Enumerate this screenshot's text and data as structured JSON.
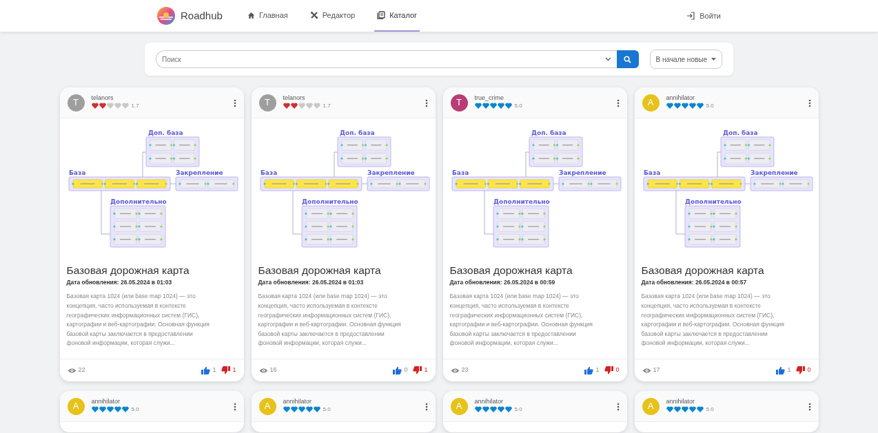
{
  "navbar": {
    "logo": "Roadhub",
    "links": [
      {
        "label": "Главная",
        "selected": false
      },
      {
        "label": "Редактор",
        "selected": false
      },
      {
        "label": "Каталог",
        "selected": true
      }
    ],
    "login": "Войти"
  },
  "search": {
    "placeholder": "Поиск",
    "sort": "В начале новые"
  },
  "cards": [
    {
      "author": "telanors",
      "avatar": {
        "letter": "T",
        "color": "#9e9e9e"
      },
      "rating": {
        "stars": 2,
        "color": "#d32f2f",
        "value": "1.7"
      },
      "groups": [
        "Доп. база",
        "База",
        "Закрепление",
        "Дополнительно"
      ],
      "title": "Базовая дорожная карта",
      "updated": "Дата обновления: 26.05.2024 в 01:03",
      "description": "Базовая карта 1024 (или base map 1024) — это концепция, часто используемая в контексте географических информационных систем (ГИС), картографии и веб-картографии. Основная функция базовой карты заключается в предоставлении фоновой информации, которая служи...",
      "views": "22",
      "likes": "1",
      "dislikes": "1"
    },
    {
      "author": "telanors",
      "avatar": {
        "letter": "T",
        "color": "#9e9e9e"
      },
      "rating": {
        "stars": 2,
        "color": "#d32f2f",
        "value": "1.7"
      },
      "groups": [
        "Доп. база",
        "База",
        "Закрепление",
        "Дополнительно"
      ],
      "title": "Базовая дорожная карта",
      "updated": "Дата обновления: 26.05.2024 в 01:03",
      "description": "Базовая карта 1024 (или base map 1024) — это концепция, часто используемая в контексте географических информационных систем (ГИС), картографии и веб-картографии. Основная функция базовой карты заключается в предоставлении фоновой информации, которая служи...",
      "views": "16",
      "likes": "0",
      "dislikes": "1"
    },
    {
      "author": "true_crime",
      "avatar": {
        "letter": "T",
        "color": "#b83d74"
      },
      "rating": {
        "stars": 5,
        "color": "#0a86d0",
        "value": "5.0"
      },
      "groups": [
        "Доп. база",
        "База",
        "Закрепление",
        "Дополнительно"
      ],
      "title": "Базовая дорожная карта",
      "updated": "Дата обновления: 26.05.2024 в 00:59",
      "description": "Базовая карта 1024 (или base map 1024) — это концепция, часто используемая в контексте географических информационных систем (ГИС), картографии и веб-картографии. Основная функция базовой карты заключается в предоставлении фоновой информации, которая служи...",
      "views": "23",
      "likes": "1",
      "dislikes": "0"
    },
    {
      "author": "annihilator",
      "avatar": {
        "letter": "A",
        "color": "#e6c21a"
      },
      "rating": {
        "stars": 5,
        "color": "#0a86d0",
        "value": "5.0"
      },
      "groups": [
        "Доп. база",
        "База",
        "Закрепление",
        "Дополнительно"
      ],
      "title": "Базовая дорожная карта",
      "updated": "Дата обновления: 26.05.2024 в 00:57",
      "description": "Базовая карта 1024 (или base map 1024) — это концепция, часто используемая в контексте географических информационных систем (ГИС), картографии и веб-картографии. Основная функция базовой карты заключается в предоставлении фоновой информации, которая служи...",
      "views": "17",
      "likes": "1",
      "dislikes": "0"
    },
    {
      "author": "annihilator",
      "avatar": {
        "letter": "A",
        "color": "#e6c21a"
      },
      "rating": {
        "stars": 5,
        "color": "#0a86d0",
        "value": "5.0"
      }
    },
    {
      "author": "annihilator",
      "avatar": {
        "letter": "A",
        "color": "#e6c21a"
      },
      "rating": {
        "stars": 5,
        "color": "#0a86d0",
        "value": "5.0"
      }
    },
    {
      "author": "annihilator",
      "avatar": {
        "letter": "A",
        "color": "#e6c21a"
      },
      "rating": {
        "stars": 5,
        "color": "#0a86d0",
        "value": "5.0"
      }
    },
    {
      "author": "annihilator",
      "avatar": {
        "letter": "A",
        "color": "#e6c21a"
      },
      "rating": {
        "stars": 5,
        "color": "#0a86d0",
        "value": "5.0"
      }
    }
  ]
}
